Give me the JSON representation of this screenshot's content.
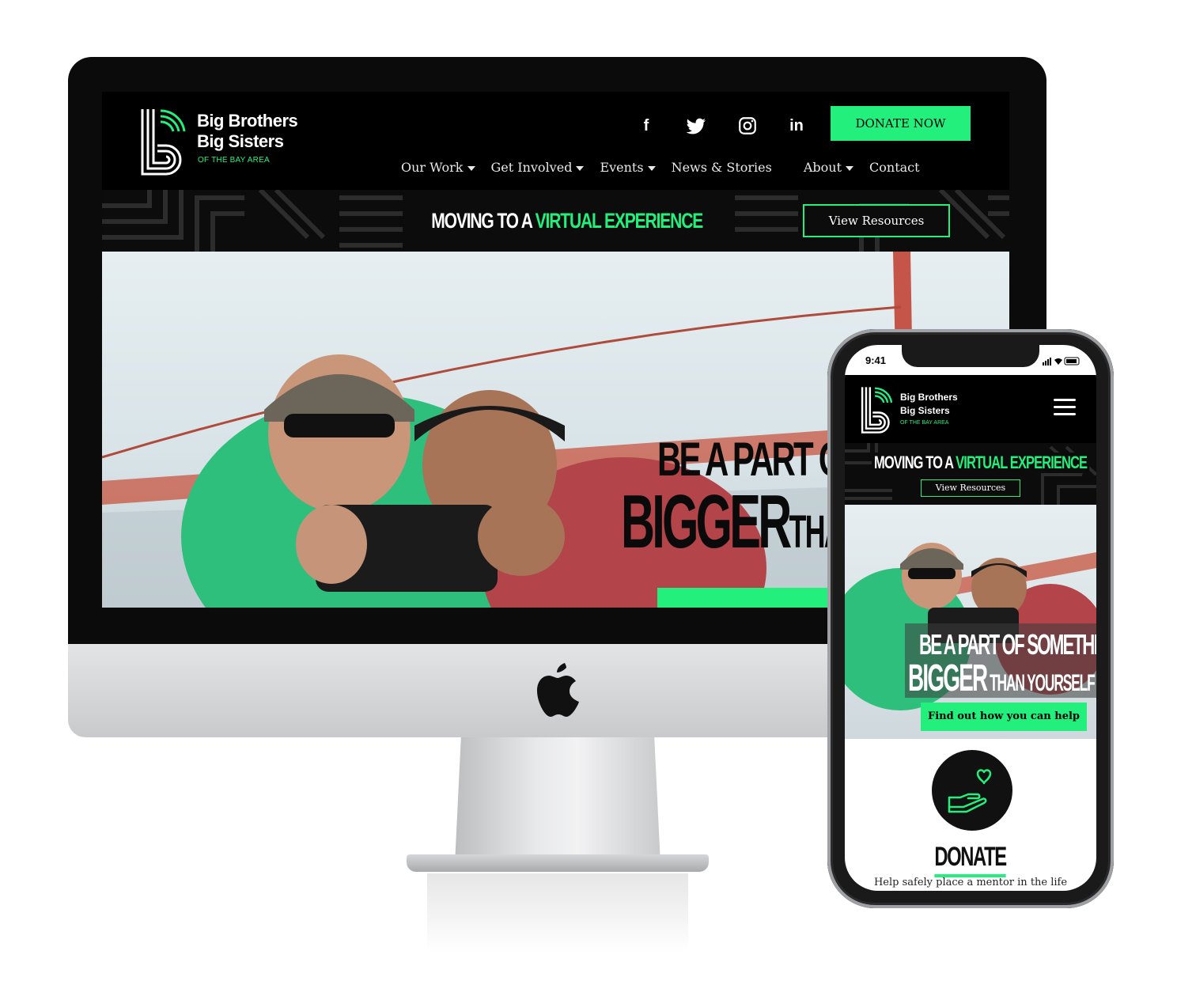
{
  "desktop": {
    "logo": {
      "line1": "Big Brothers",
      "line2": "Big Sisters",
      "sub": "OF THE BAY AREA"
    },
    "social": [
      {
        "name": "facebook-icon",
        "glyph": "f"
      },
      {
        "name": "twitter-icon",
        "glyph": ""
      },
      {
        "name": "instagram-icon",
        "glyph": ""
      },
      {
        "name": "linkedin-icon",
        "glyph": "in"
      }
    ],
    "donate_label": "DONATE NOW",
    "nav": [
      {
        "label": "Our Work",
        "dropdown": true
      },
      {
        "label": "Get Involved",
        "dropdown": true
      },
      {
        "label": "Events",
        "dropdown": true
      },
      {
        "label": "News & Stories",
        "dropdown": false
      },
      {
        "label": "About",
        "dropdown": true
      },
      {
        "label": "Contact",
        "dropdown": false
      }
    ],
    "banner": {
      "title_a": "MOVING TO A ",
      "title_b": "VIRTUAL EXPERIENCE",
      "button": "View Resources"
    },
    "hero": {
      "line1": "BE A PART OF S",
      "line2_big": "BIGGER",
      "line2_small": "THAN"
    }
  },
  "mobile": {
    "status_time": "9:41",
    "logo": {
      "line1": "Big Brothers",
      "line2": "Big Sisters",
      "sub": "OF THE BAY AREA"
    },
    "banner": {
      "title_a": "MOVING TO A ",
      "title_b": "VIRTUAL EXPERIENCE",
      "button": "View Resources"
    },
    "hero": {
      "line1": "BE A PART OF SOMETHING",
      "line2_big": "BIGGER",
      "line2_small": " THAN YOURSELF",
      "cta": "Find out how you can help"
    },
    "donate": {
      "title": "DONATE",
      "text": "Help safely place a mentor in the life"
    }
  },
  "colors": {
    "accent": "#23f07c",
    "dark": "#000000"
  }
}
